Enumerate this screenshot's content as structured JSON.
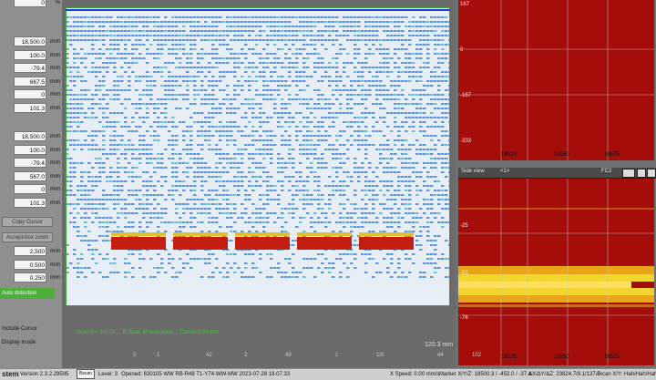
{
  "left_panel": {
    "top_value": "0",
    "top_unit": "%",
    "group1": [
      {
        "value": "18,500.0",
        "unit": "mm"
      },
      {
        "value": "100.0",
        "unit": "mm"
      },
      {
        "value": "-79.4",
        "unit": "mm"
      },
      {
        "value": "667.5",
        "unit": "mm"
      },
      {
        "value": "0",
        "unit": "mm"
      },
      {
        "value": "101.3",
        "unit": "mm"
      }
    ],
    "group2": [
      {
        "value": "18,500.0",
        "unit": "mm"
      },
      {
        "value": "100.0",
        "unit": "mm"
      },
      {
        "value": "-79.4",
        "unit": "mm"
      },
      {
        "value": "567.0",
        "unit": "mm"
      },
      {
        "value": "0",
        "unit": "mm"
      },
      {
        "value": "101.3",
        "unit": "mm"
      }
    ],
    "copy_button": "Copy Cursor",
    "zoom_button": "Accept-box zoom",
    "group3": [
      {
        "value": "2.500",
        "unit": "mm"
      },
      {
        "value": "0.500",
        "unit": "mm"
      },
      {
        "value": "0.250",
        "unit": "mm"
      }
    ],
    "green_item": "Auto detection",
    "checkbox_label": "Include Cursor",
    "display_label": "Display Inside"
  },
  "bscan": {
    "status_text": "Scan 0 + 1/0 T1  ... B-Scan all data area ... Cursor 0.00 mm",
    "scale_label": "120.3 mm",
    "x_ticks": [
      "0",
      "1",
      "42",
      "2",
      "43",
      "1",
      "1/0",
      "44",
      "102"
    ]
  },
  "top_right": {
    "y_ticks": [
      "167",
      "0",
      "-167",
      "-333"
    ],
    "x_ticks": [
      "18525",
      "18550",
      "18575"
    ]
  },
  "side_view": {
    "title": "Side view",
    "center_label": "<1>",
    "right_label": "FC2",
    "y_ticks": [
      "-25",
      "-51",
      "-76"
    ],
    "x_ticks": [
      "18525",
      "18550",
      "18575"
    ]
  },
  "footer": {
    "brand": "stem",
    "version": "Version 2.3.2.29595",
    "icon1": "Bscan",
    "level": "Level: 3",
    "opened": "Opened: 630105 WW RB-R48 T1-Y74-WW-MW 2023-07-28 18.07.33",
    "xspeed": "X Speed: 0.00 mm/s",
    "marker": "Marker X/Y/Z: 18500.3 / -452.0 / -37.4",
    "delta": "ΔX/ΔY/ΔZ: 23824.7/9.1/137.7",
    "axcan": "Axcan X/Y: Hah/Hah/Hah"
  },
  "colors": {
    "red_panel": "#a50d0a",
    "accent_green": "#4caf3a",
    "scan_blue": "#2a6fc7"
  }
}
